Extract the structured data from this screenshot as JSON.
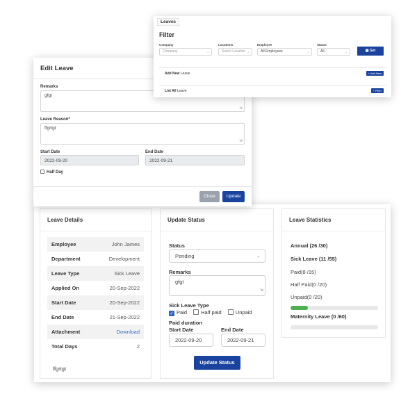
{
  "leave_details": {
    "title": "Leave Details",
    "rows": [
      {
        "key": "Employee",
        "value": "John James"
      },
      {
        "key": "Department",
        "value": "Development"
      },
      {
        "key": "Leave Type",
        "value": "Sick Leave"
      },
      {
        "key": "Applied On",
        "value": "20-Sep-2022"
      },
      {
        "key": "Start Date",
        "value": "20-Sep-2022"
      },
      {
        "key": "End Date",
        "value": "21-Sep-2022"
      },
      {
        "key": "Attachment",
        "value": "Download"
      },
      {
        "key": "Total Days",
        "value": "2"
      }
    ],
    "reason": "ffgrtgt"
  },
  "update_status": {
    "title": "Update Status",
    "status_label": "Status",
    "status_value": "Pending",
    "remarks_label": "Remarks",
    "remarks_value": "gfgt",
    "sick_type_label": "Sick Leave Type",
    "options": [
      {
        "label": "Paid",
        "checked": true
      },
      {
        "label": "Half paid",
        "checked": false
      },
      {
        "label": "Unpaid",
        "checked": false
      }
    ],
    "paid_duration_label": "Paid duration",
    "start_label": "Start Date",
    "start_value": "2022-09-20",
    "end_label": "End Date",
    "end_value": "2022-09-21",
    "button": "Update Status"
  },
  "leave_statistics": {
    "title": "Leave Statistics",
    "annual": "Annual (26 /30)",
    "sick": "Sick Leave (11 /55)",
    "paid": "Paid(8 /15)",
    "half_paid": "Half Paid(0 /20)",
    "unpaid": "Unpaid(0 /20)",
    "sick_progress_fraction": 0.2,
    "maternity": "Maternity Leave (0 /60)",
    "maternity_progress_fraction": 0,
    "progress_color": "#4caf50"
  },
  "edit_modal": {
    "title": "Edit Leave",
    "remarks_label": "Remarks",
    "remarks_value": "gfgt",
    "reason_label": "Leave Reason*",
    "reason_value": "ffgrtgt",
    "start_label": "Start Date",
    "start_value": "2022-09-20",
    "end_label": "End Date",
    "end_value": "2022-09-21",
    "half_day_label": "Half Day",
    "close_button": "Close",
    "update_button": "Update"
  },
  "leaves_panel": {
    "tab": "Leaves",
    "filter_title": "Filter",
    "company_label": "Company",
    "company_placeholder": "Company",
    "locations_label": "Locations",
    "locations_placeholder": "Select Location",
    "employee_label": "Employee",
    "employee_value": "All Employees",
    "status_label": "Status",
    "status_value": "All",
    "get_button": "Get",
    "add_new_bold": "Add New",
    "add_new_rest": " Leave",
    "add_new_button": "+ Add New",
    "list_all_bold": "List All",
    "list_all_rest": " Leave",
    "filter_button": "+ Filter"
  },
  "colors": {
    "primary": "#1a43a0",
    "close_button": "#9aa3ad",
    "link": "#3a6fc4"
  }
}
